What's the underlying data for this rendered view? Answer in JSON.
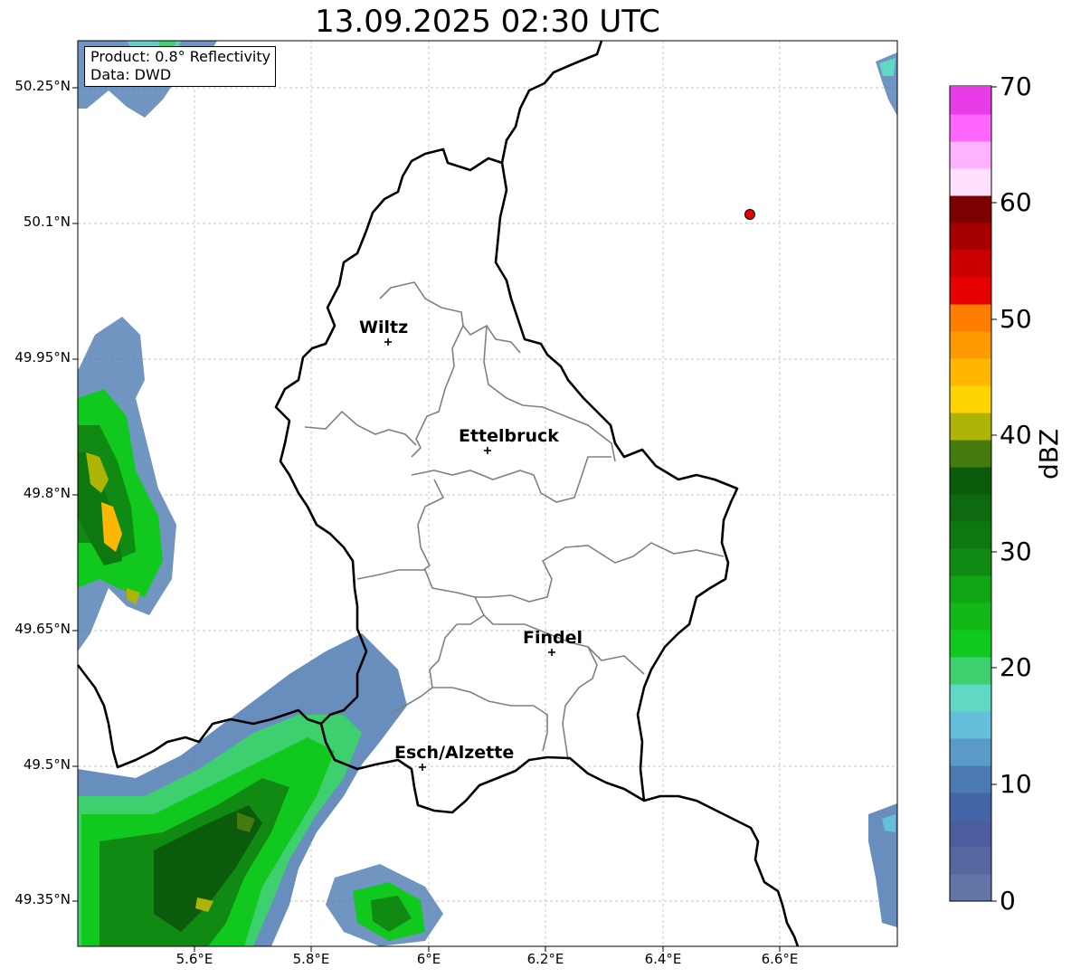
{
  "title": "13.09.2025 02:30 UTC",
  "info": {
    "product": "Product: 0.8° Reflectivity",
    "source": "Data: DWD"
  },
  "lat_labels": [
    "50.25°N",
    "50.1°N",
    "49.95°N",
    "49.8°N",
    "49.65°N",
    "49.5°N",
    "49.35°N"
  ],
  "lon_labels": [
    "5.6°E",
    "5.8°E",
    "6°E",
    "6.2°E",
    "6.4°E",
    "6.6°E"
  ],
  "cities": [
    {
      "name": "Wiltz"
    },
    {
      "name": "Ettelbruck"
    },
    {
      "name": "Findel"
    },
    {
      "name": "Esch/Alzette"
    }
  ],
  "colorbar": {
    "unit": "dBZ",
    "ticks": [
      "70",
      "60",
      "50",
      "40",
      "30",
      "20",
      "10",
      "0"
    ],
    "colors": [
      "#6475a8",
      "#56689f",
      "#4d5ea0",
      "#4466a8",
      "#4d7ab2",
      "#5a9ac6",
      "#63bfda",
      "#5fd8c4",
      "#3ecf6e",
      "#11c81e",
      "#12b818",
      "#11a614",
      "#108a12",
      "#0d7810",
      "#0e6a0e",
      "#0c5a0c",
      "#457a0c",
      "#aeb405",
      "#ffd500",
      "#ffb702",
      "#ff9a00",
      "#ff7d00",
      "#e60000",
      "#cc0000",
      "#a80000",
      "#7d0000",
      "#ffe0ff",
      "#ffb3ff",
      "#ff66ff",
      "#e83ce8"
    ],
    "range": [
      0,
      70
    ]
  },
  "colors": {
    "border": "#000000",
    "canton_lines": "#808080",
    "grid": "#b0b0b0",
    "radar_site": "#e60000"
  }
}
